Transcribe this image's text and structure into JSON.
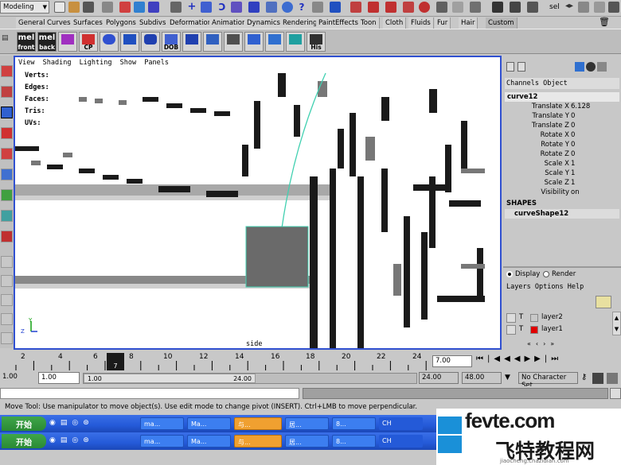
{
  "top_toolbar": {
    "mode": "Modeling",
    "selection_label": "sel"
  },
  "shelf_tabs": [
    "General",
    "Curves",
    "Surfaces",
    "Polygons",
    "Subdivs",
    "Deformation",
    "Animation",
    "Dynamics",
    "Rendering",
    "PaintEffects",
    "Toon",
    "Cloth",
    "Fluids",
    "Fur",
    "Hair",
    "Custom"
  ],
  "shelf_buttons": [
    {
      "label": "mel\nfront",
      "icon": "mel-script-icon"
    },
    {
      "label": "mel\nback",
      "icon": "mel-script-icon"
    },
    {
      "label": "",
      "icon": "curve-cross-icon"
    },
    {
      "label": "CP",
      "icon": "curve-project-icon"
    },
    {
      "label": "",
      "icon": "sphere-icon"
    },
    {
      "label": "",
      "icon": "cube-icon"
    },
    {
      "label": "",
      "icon": "cylinder-icon"
    },
    {
      "label": "DOB",
      "icon": "dob-icon"
    },
    {
      "label": "",
      "icon": "plane-icon"
    },
    {
      "label": "",
      "icon": "extrude-icon"
    },
    {
      "label": "",
      "icon": "brush-icon"
    },
    {
      "label": "",
      "icon": "snap-icon"
    },
    {
      "label": "",
      "icon": "move-pivot-icon"
    },
    {
      "label": "",
      "icon": "grid-icon"
    },
    {
      "label": "His",
      "icon": "history-icon"
    }
  ],
  "viewport": {
    "menu": [
      "View",
      "Shading",
      "Lighting",
      "Show",
      "Panels"
    ],
    "hud": [
      "Verts:",
      "Edges:",
      "Faces:",
      "Tris:",
      "UVs:"
    ],
    "camera_label": "side",
    "axis_labels": {
      "y": "Y",
      "z": "Z"
    }
  },
  "channel_box": {
    "tabs": [
      "Channels",
      "Object"
    ],
    "object_name": "curve12",
    "attributes": [
      {
        "name": "Translate X",
        "value": "6.128"
      },
      {
        "name": "Translate Y",
        "value": "0"
      },
      {
        "name": "Translate Z",
        "value": "0"
      },
      {
        "name": "Rotate X",
        "value": "0"
      },
      {
        "name": "Rotate Y",
        "value": "0"
      },
      {
        "name": "Rotate Z",
        "value": "0"
      },
      {
        "name": "Scale X",
        "value": "1"
      },
      {
        "name": "Scale Y",
        "value": "1"
      },
      {
        "name": "Scale Z",
        "value": "1"
      },
      {
        "name": "Visibility",
        "value": "on"
      }
    ],
    "shapes_header": "SHAPES",
    "shape_name": "curveShape12"
  },
  "layer_editor": {
    "display_label": "Display",
    "render_label": "Render",
    "menu": [
      "Layers",
      "Options",
      "Help"
    ],
    "layers": [
      {
        "name": "layer2",
        "visibility": "T",
        "color": "#c8c8c8"
      },
      {
        "name": "layer1",
        "visibility": "T",
        "color": "#e00000"
      }
    ]
  },
  "timeline": {
    "ticks": [
      "2",
      "4",
      "6",
      "8",
      "10",
      "12",
      "14",
      "16",
      "18",
      "20",
      "22",
      "24"
    ],
    "current_frame": "7",
    "current_time_field": "7.00"
  },
  "range_slider": {
    "start_time": "1.00",
    "playback_start": "1.00",
    "playback_end": "24.00",
    "end_time": "48.00",
    "range_bar_left": "1.00",
    "range_bar_right": "24.00",
    "character_set": "No Character Set"
  },
  "help_line": "Move Tool: Use manipulator to move object(s). Use edit mode to change pivot (INSERT). Ctrl+LMB to move perpendicular.",
  "taskbar1": {
    "start": "开始",
    "items": [
      "ma...",
      "Ma...",
      "与...",
      "居...",
      "8...",
      "CH"
    ]
  },
  "taskbar2": {
    "start": "开始",
    "items": [
      "ma...",
      "Ma...",
      "与...",
      "居...",
      "8...",
      "CH"
    ]
  },
  "watermark": {
    "site": "fevte.com",
    "cn_text": "飞特教程网",
    "url": "jiaocheng.chazidian.com"
  },
  "colors": {
    "viewport_border": "#3050d0",
    "selection_box": "#6a6a6a",
    "curve": "#40d0b0",
    "taskbar": "#245ad8",
    "layer1": "#e00000"
  }
}
